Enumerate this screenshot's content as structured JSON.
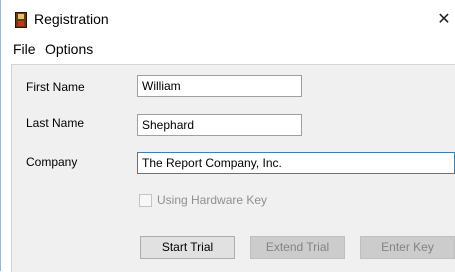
{
  "window": {
    "title": "Registration",
    "close_glyph": "✕",
    "icon": "app-icon"
  },
  "menu": {
    "file": "File",
    "options": "Options"
  },
  "form": {
    "first_name_label": "First Name",
    "first_name_value": "William",
    "last_name_label": "Last Name",
    "last_name_value": "Shephard",
    "company_label": "Company",
    "company_value": "The Report Company, Inc.",
    "hardware_key_label": "Using Hardware Key",
    "hardware_key_checked": false
  },
  "buttons": {
    "start_trial": "Start Trial",
    "extend_trial": "Extend Trial",
    "enter_key": "Enter Key"
  },
  "colors": {
    "panel_bg": "#f0f0f0",
    "active_border": "#3c7fb1",
    "disabled_text": "#838383"
  }
}
